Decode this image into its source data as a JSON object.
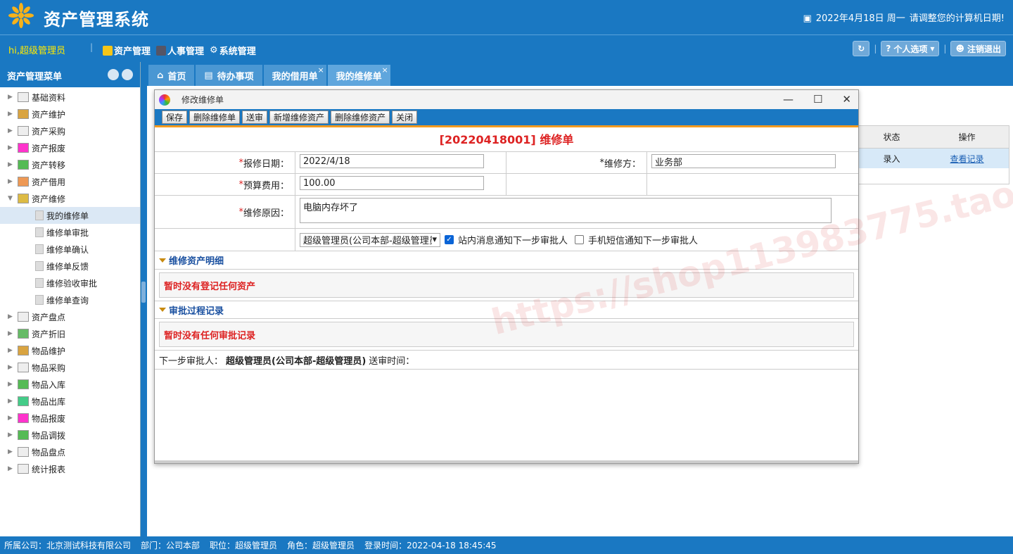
{
  "app": {
    "title": "资产管理系统",
    "date": "2022年4月18日 周一",
    "date_note": "请调整您的计算机日期!"
  },
  "user": {
    "greeting": "hi,超级管理员"
  },
  "modules": [
    "资产管理",
    "人事管理",
    "系统管理"
  ],
  "right_buttons": {
    "personal": "个人选项",
    "logout": "注销退出"
  },
  "sidebar": {
    "title": "资产管理菜单",
    "items": [
      {
        "label": "基础资料"
      },
      {
        "label": "资产维护"
      },
      {
        "label": "资产采购"
      },
      {
        "label": "资产报废"
      },
      {
        "label": "资产转移"
      },
      {
        "label": "资产借用"
      },
      {
        "label": "资产维修"
      }
    ],
    "sub_items": [
      {
        "label": "我的维修单"
      },
      {
        "label": "维修单审批"
      },
      {
        "label": "维修单确认"
      },
      {
        "label": "维修单反馈"
      },
      {
        "label": "维修验收审批"
      },
      {
        "label": "维修单查询"
      }
    ],
    "items2": [
      {
        "label": "资产盘点"
      },
      {
        "label": "资产折旧"
      },
      {
        "label": "物品维护"
      },
      {
        "label": "物品采购"
      },
      {
        "label": "物品入库"
      },
      {
        "label": "物品出库"
      },
      {
        "label": "物品报废"
      },
      {
        "label": "物品调拨"
      },
      {
        "label": "物品盘点"
      },
      {
        "label": "统计报表"
      }
    ]
  },
  "tabs": [
    {
      "label": "首页"
    },
    {
      "label": "待办事项"
    },
    {
      "label": "我的借用单"
    },
    {
      "label": "我的维修单"
    }
  ],
  "bg_table": {
    "col_status": "状态",
    "col_action": "操作",
    "status": "录入",
    "action": "查看记录"
  },
  "dialog": {
    "title": "修改维修单",
    "toolbar": [
      "保存",
      "删除维修单",
      "送审",
      "新增维修资产",
      "删除维修资产",
      "关闭"
    ],
    "heading": "[20220418001] 维修单",
    "repair_date_label": "报修日期：",
    "repair_date": "2022/4/18",
    "repair_party_label": "维修方：",
    "repair_party": "业务部",
    "budget_label": "预算费用：",
    "budget": "100.00",
    "reason_label": "维修原因：",
    "reason": "电脑内存坏了",
    "approver": "超级管理员(公司本部-超级管理员)",
    "notify_site": "站内消息通知下一步审批人",
    "notify_sms": "手机短信通知下一步审批人",
    "section_assets": "维修资产明细",
    "no_assets": "暂时没有登记任何资产",
    "section_approval": "审批过程记录",
    "no_approval": "暂时没有任何审批记录",
    "next_label": "下一步审批人：",
    "next_value": "超级管理员(公司本部-超级管理员)",
    "send_time_label": "送审时间："
  },
  "status_bar": {
    "company": "所属公司：北京测试科技有限公司",
    "dept": "部门：公司本部",
    "position": "职位：超级管理员",
    "role": "角色：超级管理员",
    "login": "登录时间：2022-04-18 18:45:45"
  },
  "watermark": "https://shop113983775.taobao.com"
}
